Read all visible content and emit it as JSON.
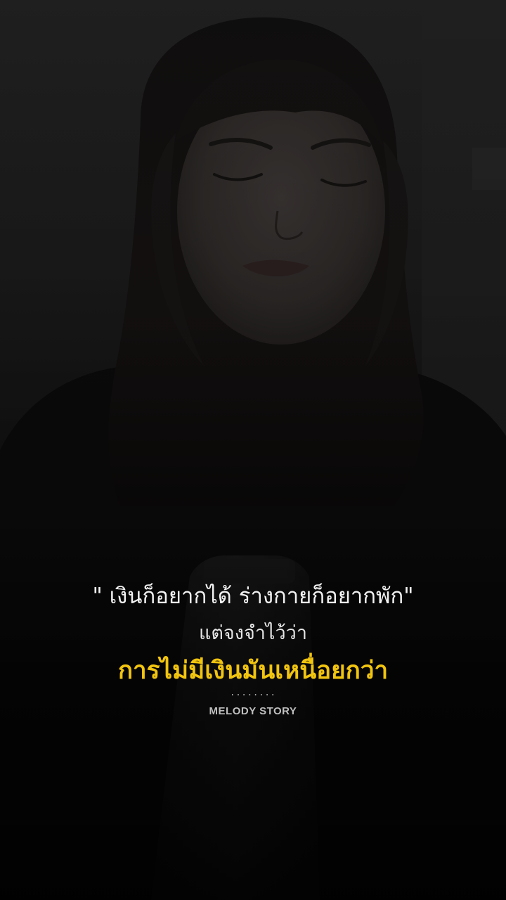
{
  "caption": {
    "quote": "\" เงินก็อยากได้ ร่างกายก็อยากพัก\"",
    "subline": "แต่จงจำไว้ว่า",
    "highlight": "การไม่มีเงินมันเหนื่อยกว่า",
    "separator": "........",
    "brand": "MELODY STORY"
  },
  "colors": {
    "highlight": "#f1c40f",
    "text": "#f2f2f2",
    "brand": "#bfbfbf"
  }
}
